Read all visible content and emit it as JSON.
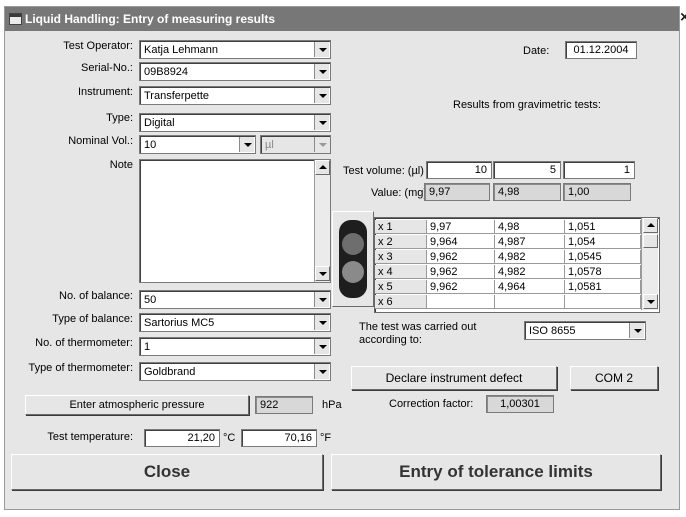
{
  "window": {
    "title": "Liquid Handling: Entry of measuring results",
    "close_glyph": "×"
  },
  "form": {
    "test_operator": {
      "label": "Test Operator:",
      "value": "Katja Lehmann"
    },
    "serial_no": {
      "label": "Serial-No.:",
      "value": "09B8924"
    },
    "instrument": {
      "label": "Instrument:",
      "value": "Transferpette"
    },
    "type": {
      "label": "Type:",
      "value": "Digital"
    },
    "nominal_vol": {
      "label": "Nominal Vol.:",
      "value": "10",
      "unit": "µl"
    },
    "note": {
      "label": "Note",
      "value": ""
    },
    "no_of_balance": {
      "label": "No. of balance:",
      "value": "50"
    },
    "type_of_balance": {
      "label": "Type of balance:",
      "value": "Sartorius MC5"
    },
    "no_of_thermometer": {
      "label": "No. of thermometer:",
      "value": "1"
    },
    "type_of_thermometer": {
      "label": "Type of thermometer:",
      "value": "Goldbrand"
    },
    "atmospheric_pressure": {
      "button_label": "Enter atmospheric pressure",
      "value": "922",
      "unit": "hPa"
    },
    "test_temperature": {
      "label": "Test temperature:",
      "celsius": "21,20",
      "celsius_unit": "°C",
      "fahrenheit": "70,16",
      "fahrenheit_unit": "°F"
    }
  },
  "date": {
    "label": "Date:",
    "value": "01.12.2004"
  },
  "results": {
    "heading": "Results from gravimetric tests:",
    "test_volume_label": "Test volume: (µl)",
    "test_volumes": [
      "10",
      "5",
      "1"
    ],
    "value_label": "Value:  (mg)",
    "values": [
      "9,97",
      "4,98",
      "1,00"
    ],
    "rows": [
      {
        "label": "x 1",
        "cells": [
          "9,97",
          "4,98",
          "1,051"
        ]
      },
      {
        "label": "x 2",
        "cells": [
          "9,964",
          "4,987",
          "1,054"
        ]
      },
      {
        "label": "x 3",
        "cells": [
          "9,962",
          "4,982",
          "1,0545"
        ]
      },
      {
        "label": "x 4",
        "cells": [
          "9,962",
          "4,982",
          "1,0578"
        ]
      },
      {
        "label": "x 5",
        "cells": [
          "9,962",
          "4,964",
          "1,0581"
        ]
      },
      {
        "label": "x 6",
        "cells": [
          "",
          "",
          ""
        ]
      }
    ]
  },
  "standard": {
    "label": "The test was carried out according to:",
    "value": "ISO 8655"
  },
  "buttons": {
    "declare_defect": "Declare instrument defect",
    "com_port": "COM  2",
    "close": "Close",
    "tolerance": "Entry of tolerance limits"
  },
  "correction": {
    "label": "Correction factor:",
    "value": "1,00301"
  }
}
